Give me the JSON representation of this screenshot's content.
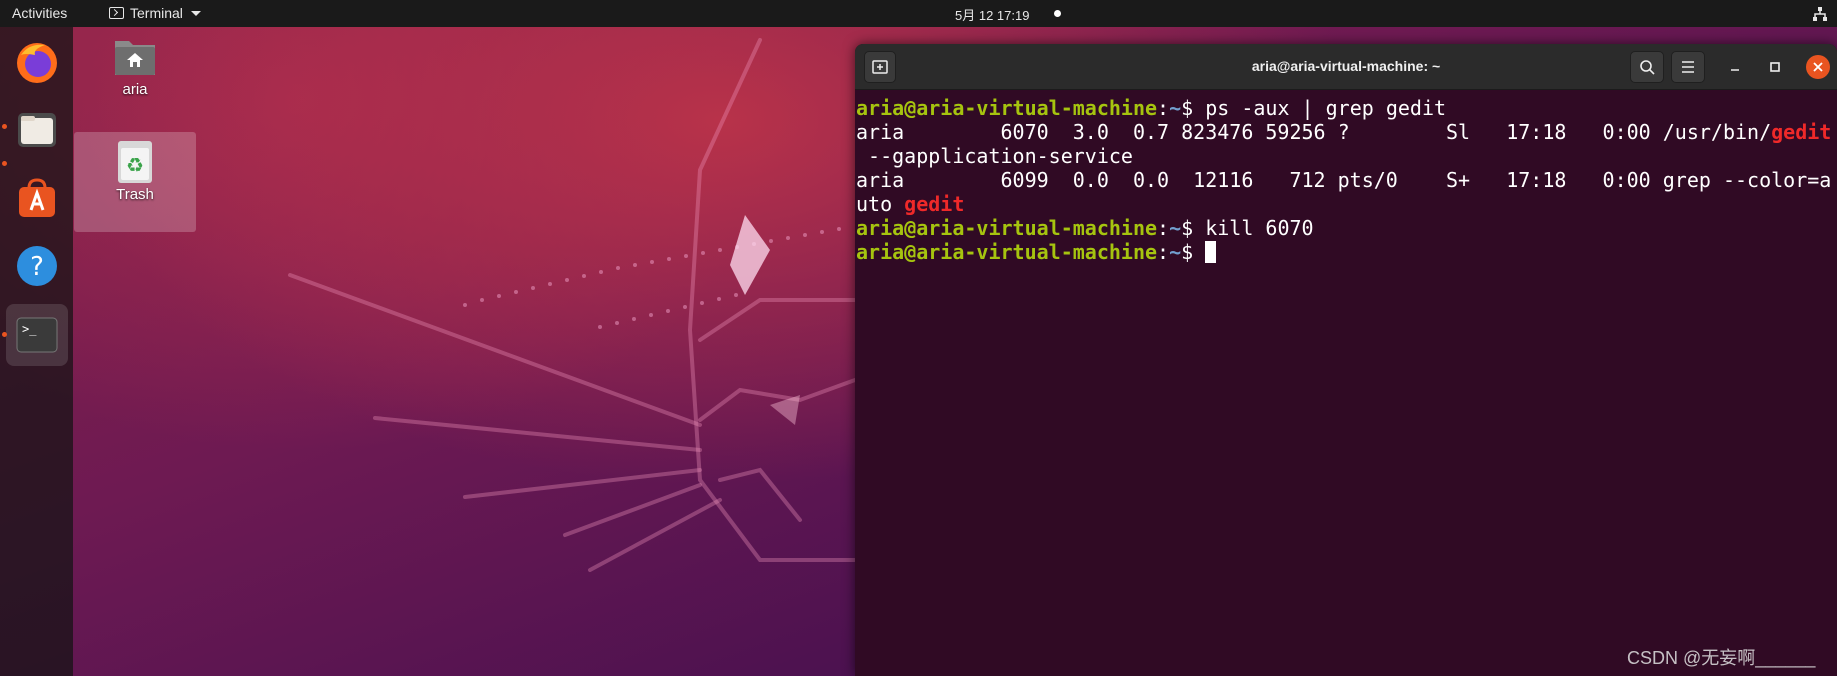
{
  "topbar": {
    "activities": "Activities",
    "app_name": "Terminal",
    "clock": "5月 12  17:19",
    "icons": [
      "terminal-icon",
      "caret-down-icon",
      "notification-dot-icon",
      "network-icon"
    ]
  },
  "dock": {
    "items": [
      {
        "name": "Firefox",
        "icon": "firefox-icon",
        "running": true
      },
      {
        "name": "Files",
        "icon": "files-icon",
        "running": true
      },
      {
        "name": "Ubuntu Software",
        "icon": "software-icon",
        "running": false
      },
      {
        "name": "Help",
        "icon": "help-icon",
        "running": false
      },
      {
        "name": "Terminal",
        "icon": "terminal-icon",
        "running": true,
        "active": true
      }
    ],
    "accent": "#e95420"
  },
  "desktop": {
    "icons": [
      {
        "label": "aria",
        "icon": "home-folder-icon"
      },
      {
        "label": "Trash",
        "icon": "trash-icon"
      }
    ]
  },
  "terminal": {
    "title": "aria@aria-virtual-machine: ~",
    "prompt_user": "aria@aria-virtual-machine",
    "prompt_sep": ":",
    "prompt_path": "~",
    "prompt_end": "$ ",
    "lines": {
      "cmd1": "ps -aux | grep gedit",
      "out1a": "aria        6070  3.0  0.7 823476 59256 ?        Sl   17:18   0:00 /usr/bin/",
      "out1b": "gedit",
      "out1c": " --gapplication-service",
      "out2a": "aria        6099  0.0  0.0  12116   712 pts/0    S+   17:18   0:00 grep --color=a",
      "out2b": "uto ",
      "out2c": "gedit",
      "cmd2": "kill 6070"
    },
    "colors": {
      "background": "#300a24",
      "prompt_user": "#a6c40f",
      "prompt_path": "#729fcf",
      "match": "#ef2929"
    }
  },
  "watermark": "CSDN @无妄啊______"
}
